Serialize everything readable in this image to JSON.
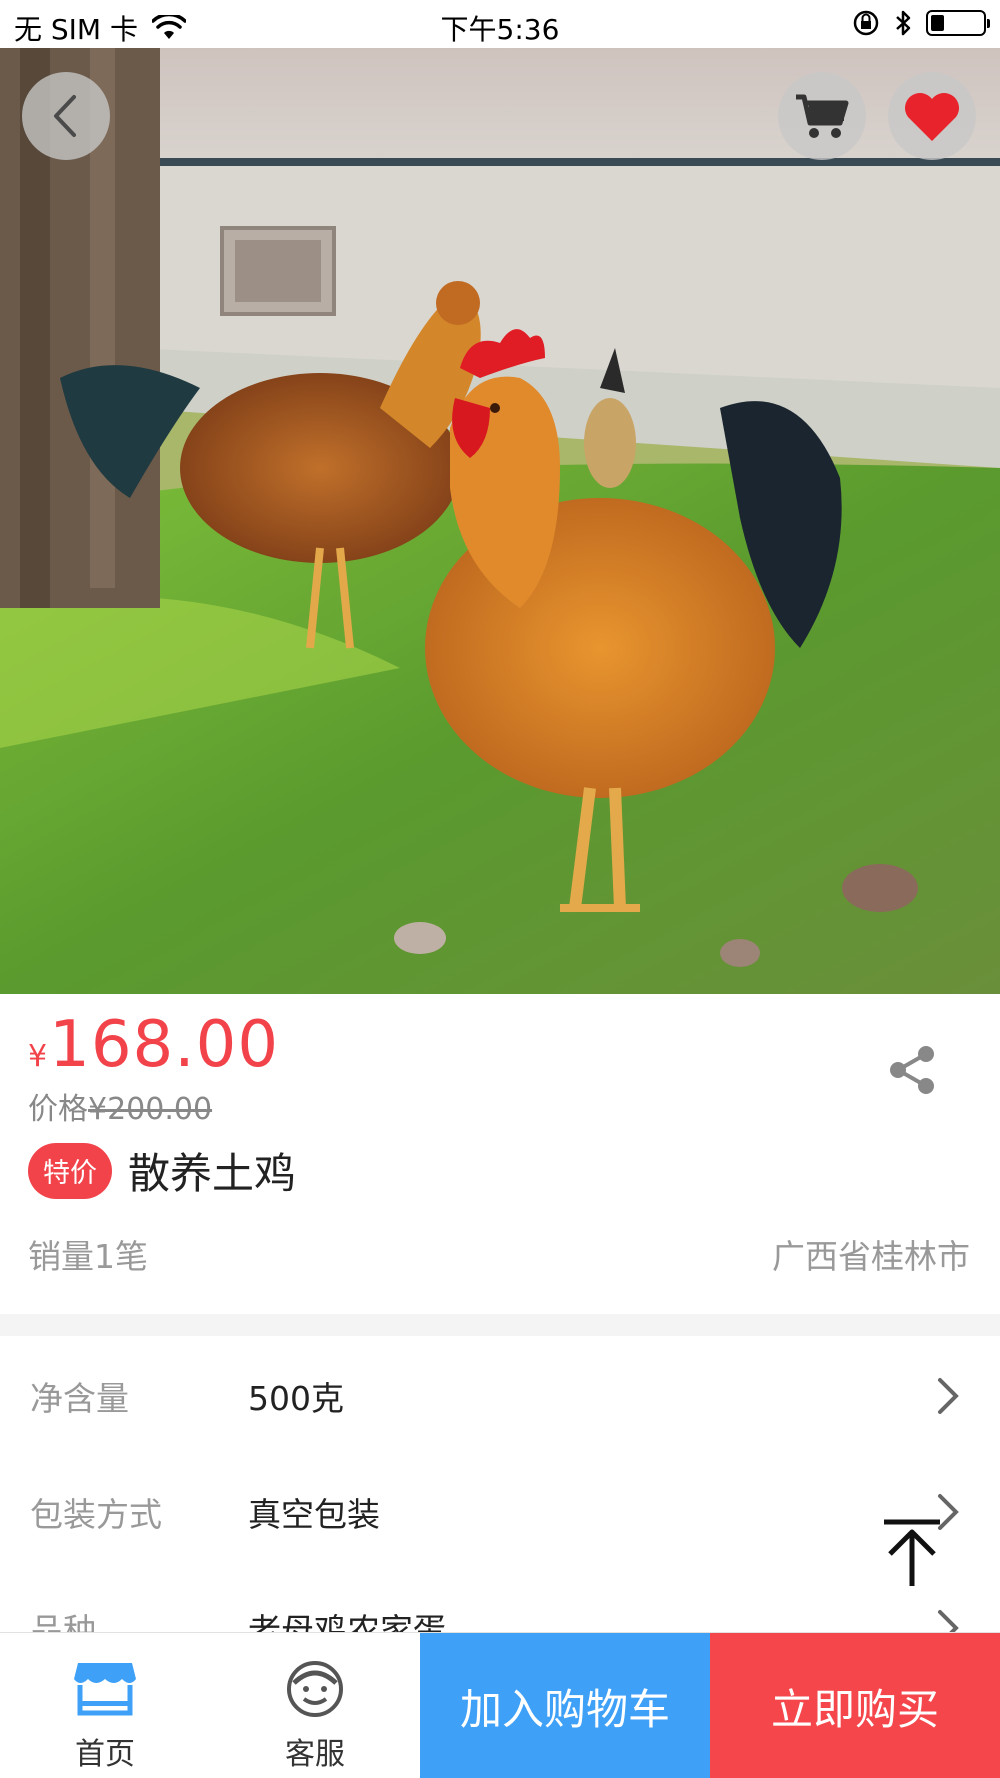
{
  "status_bar": {
    "carrier": "无 SIM 卡",
    "time": "下午5:36",
    "battery_level": 0.25
  },
  "hero": {
    "back_icon": "chevron-left-icon",
    "cart_icon": "cart-icon",
    "favorite_icon": "heart-icon"
  },
  "product": {
    "currency": "¥",
    "price": "168.00",
    "original_price_label": "价格",
    "original_price": "¥200.00",
    "tag": "特价",
    "title": "散养土鸡",
    "sales": "销量1笔",
    "location": "广西省桂林市"
  },
  "specs": [
    {
      "label": "净含量",
      "value": "500克"
    },
    {
      "label": "包装方式",
      "value": "真空包装"
    },
    {
      "label": "品种",
      "value": "老母鸡农家蛋"
    }
  ],
  "bottom_bar": {
    "home_label": "首页",
    "service_label": "客服",
    "add_to_cart": "加入购物车",
    "buy_now": "立即购买"
  },
  "colors": {
    "price_red": "#f2434b",
    "cart_blue": "#3fa0f7",
    "buy_red": "#f5464b",
    "home_icon_blue": "#3fa0f7"
  }
}
